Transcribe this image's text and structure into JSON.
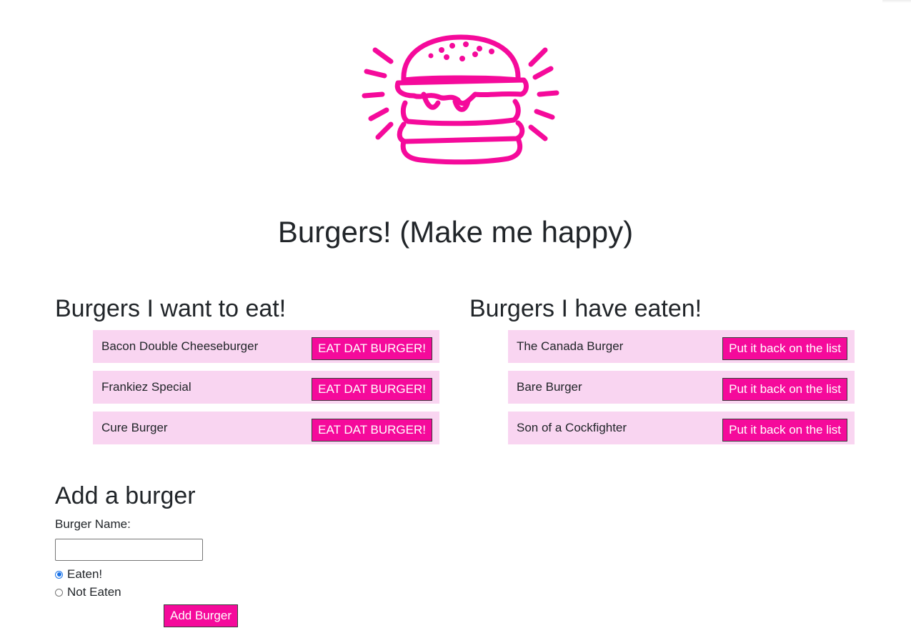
{
  "colors": {
    "accent": "#f50a9b",
    "list_item_bg": "#f9d5f1",
    "text": "#212529"
  },
  "logo": {
    "icon": "burger-logo-icon"
  },
  "page_title": "Burgers! (Make me happy)",
  "want_to_eat": {
    "heading": "Burgers I want to eat!",
    "button_label": "EAT DAT BURGER!",
    "items": [
      {
        "name": "Bacon Double Cheeseburger"
      },
      {
        "name": "Frankiez Special"
      },
      {
        "name": "Cure Burger"
      }
    ]
  },
  "eaten": {
    "heading": "Burgers I have eaten!",
    "button_label": "Put it back on the list",
    "items": [
      {
        "name": "The Canada Burger"
      },
      {
        "name": "Bare Burger"
      },
      {
        "name": "Son of a Cockfighter"
      }
    ]
  },
  "add_form": {
    "heading": "Add a burger",
    "name_label": "Burger Name:",
    "name_value": "",
    "radio_eaten_label": "Eaten!",
    "radio_not_eaten_label": "Not Eaten",
    "selected": "eaten",
    "submit_label": "Add Burger"
  }
}
